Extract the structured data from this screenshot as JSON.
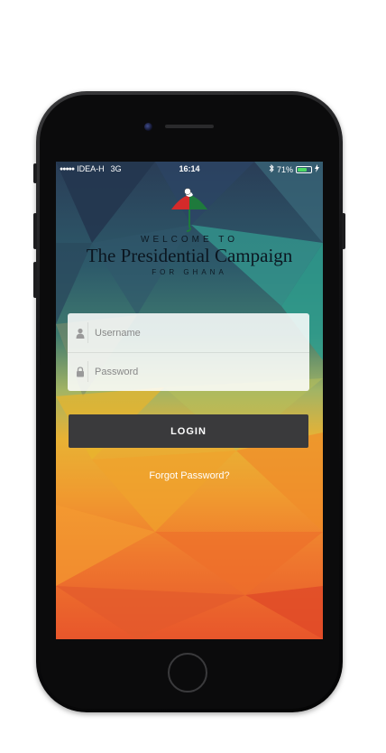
{
  "status_bar": {
    "carrier": "IDEA-H",
    "network": "3G",
    "time": "16:14",
    "battery": "71%",
    "battery_level": 0.71
  },
  "header": {
    "welcome": "WELCOME TO",
    "title": "The Presidential Campaign",
    "subtitle": "FOR GHANA"
  },
  "form": {
    "username_placeholder": "Username",
    "password_placeholder": "Password"
  },
  "login_label": "LOGIN",
  "forgot_label": "Forgot Password?",
  "colors": {
    "button": "#3a3a3c",
    "text_light": "#ffffff",
    "battery": "#4cd964"
  },
  "icons": [
    "user-icon",
    "lock-icon",
    "umbrella-logo-icon",
    "bluetooth-icon",
    "charging-icon"
  ]
}
